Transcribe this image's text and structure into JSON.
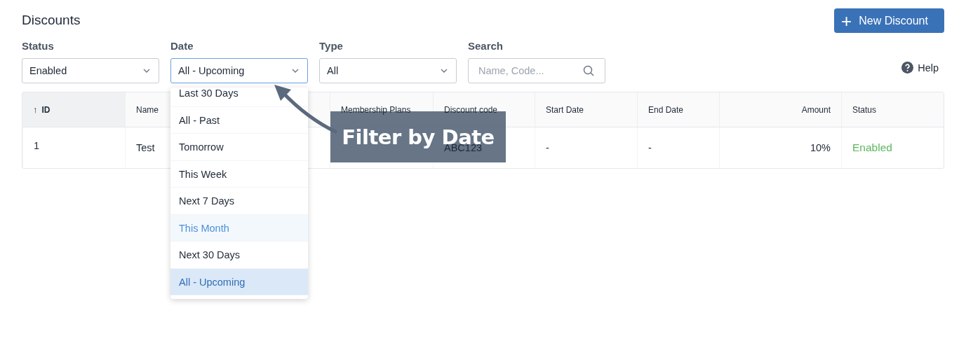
{
  "title": "Discounts",
  "new_button": {
    "icon": "+",
    "label": "New Discount"
  },
  "filters": [
    {
      "kind": "select",
      "label": "Status",
      "value": "Enabled",
      "focused": false
    },
    {
      "kind": "select",
      "label": "Date",
      "value": "All - Upcoming",
      "focused": true
    },
    {
      "kind": "select",
      "label": "Type",
      "value": "All",
      "focused": false
    },
    {
      "kind": "search",
      "label": "Search",
      "placeholder": "Name, Code..."
    }
  ],
  "help": {
    "label": "Help"
  },
  "table": {
    "columns": [
      {
        "label": "ID",
        "sort": "↑",
        "kind": "text"
      },
      {
        "label": "Name",
        "kind": "text"
      },
      {
        "kind": "text"
      },
      {
        "label": "Membership Plans",
        "kind": "text"
      },
      {
        "label": "Discount code",
        "kind": "text"
      },
      {
        "label": "Start Date",
        "kind": "text"
      },
      {
        "label": "End Date",
        "kind": "text"
      },
      {
        "label": "Amount",
        "kind": "amount"
      },
      {
        "label": "Status",
        "kind": "status"
      }
    ],
    "rows": [
      {
        "cells": [
          "1",
          "Test",
          null,
          null,
          "ABC123",
          "-",
          "-",
          "10%",
          "Enabled"
        ]
      }
    ]
  },
  "date_menu": {
    "items": [
      {
        "label": "Last 30 Days",
        "selected": false,
        "hovered": false
      },
      {
        "label": "All - Past",
        "selected": false,
        "hovered": false
      },
      {
        "label": "Tomorrow",
        "selected": false,
        "hovered": false
      },
      {
        "label": "This Week",
        "selected": false,
        "hovered": false
      },
      {
        "label": "Next 7 Days",
        "selected": false,
        "hovered": false
      },
      {
        "label": "This Month",
        "selected": false,
        "hovered": true
      },
      {
        "label": "Next 30 Days",
        "selected": false,
        "hovered": false
      },
      {
        "label": "All - Upcoming",
        "selected": true,
        "hovered": false
      }
    ]
  },
  "annotation": {
    "text": "Filter by Date"
  }
}
